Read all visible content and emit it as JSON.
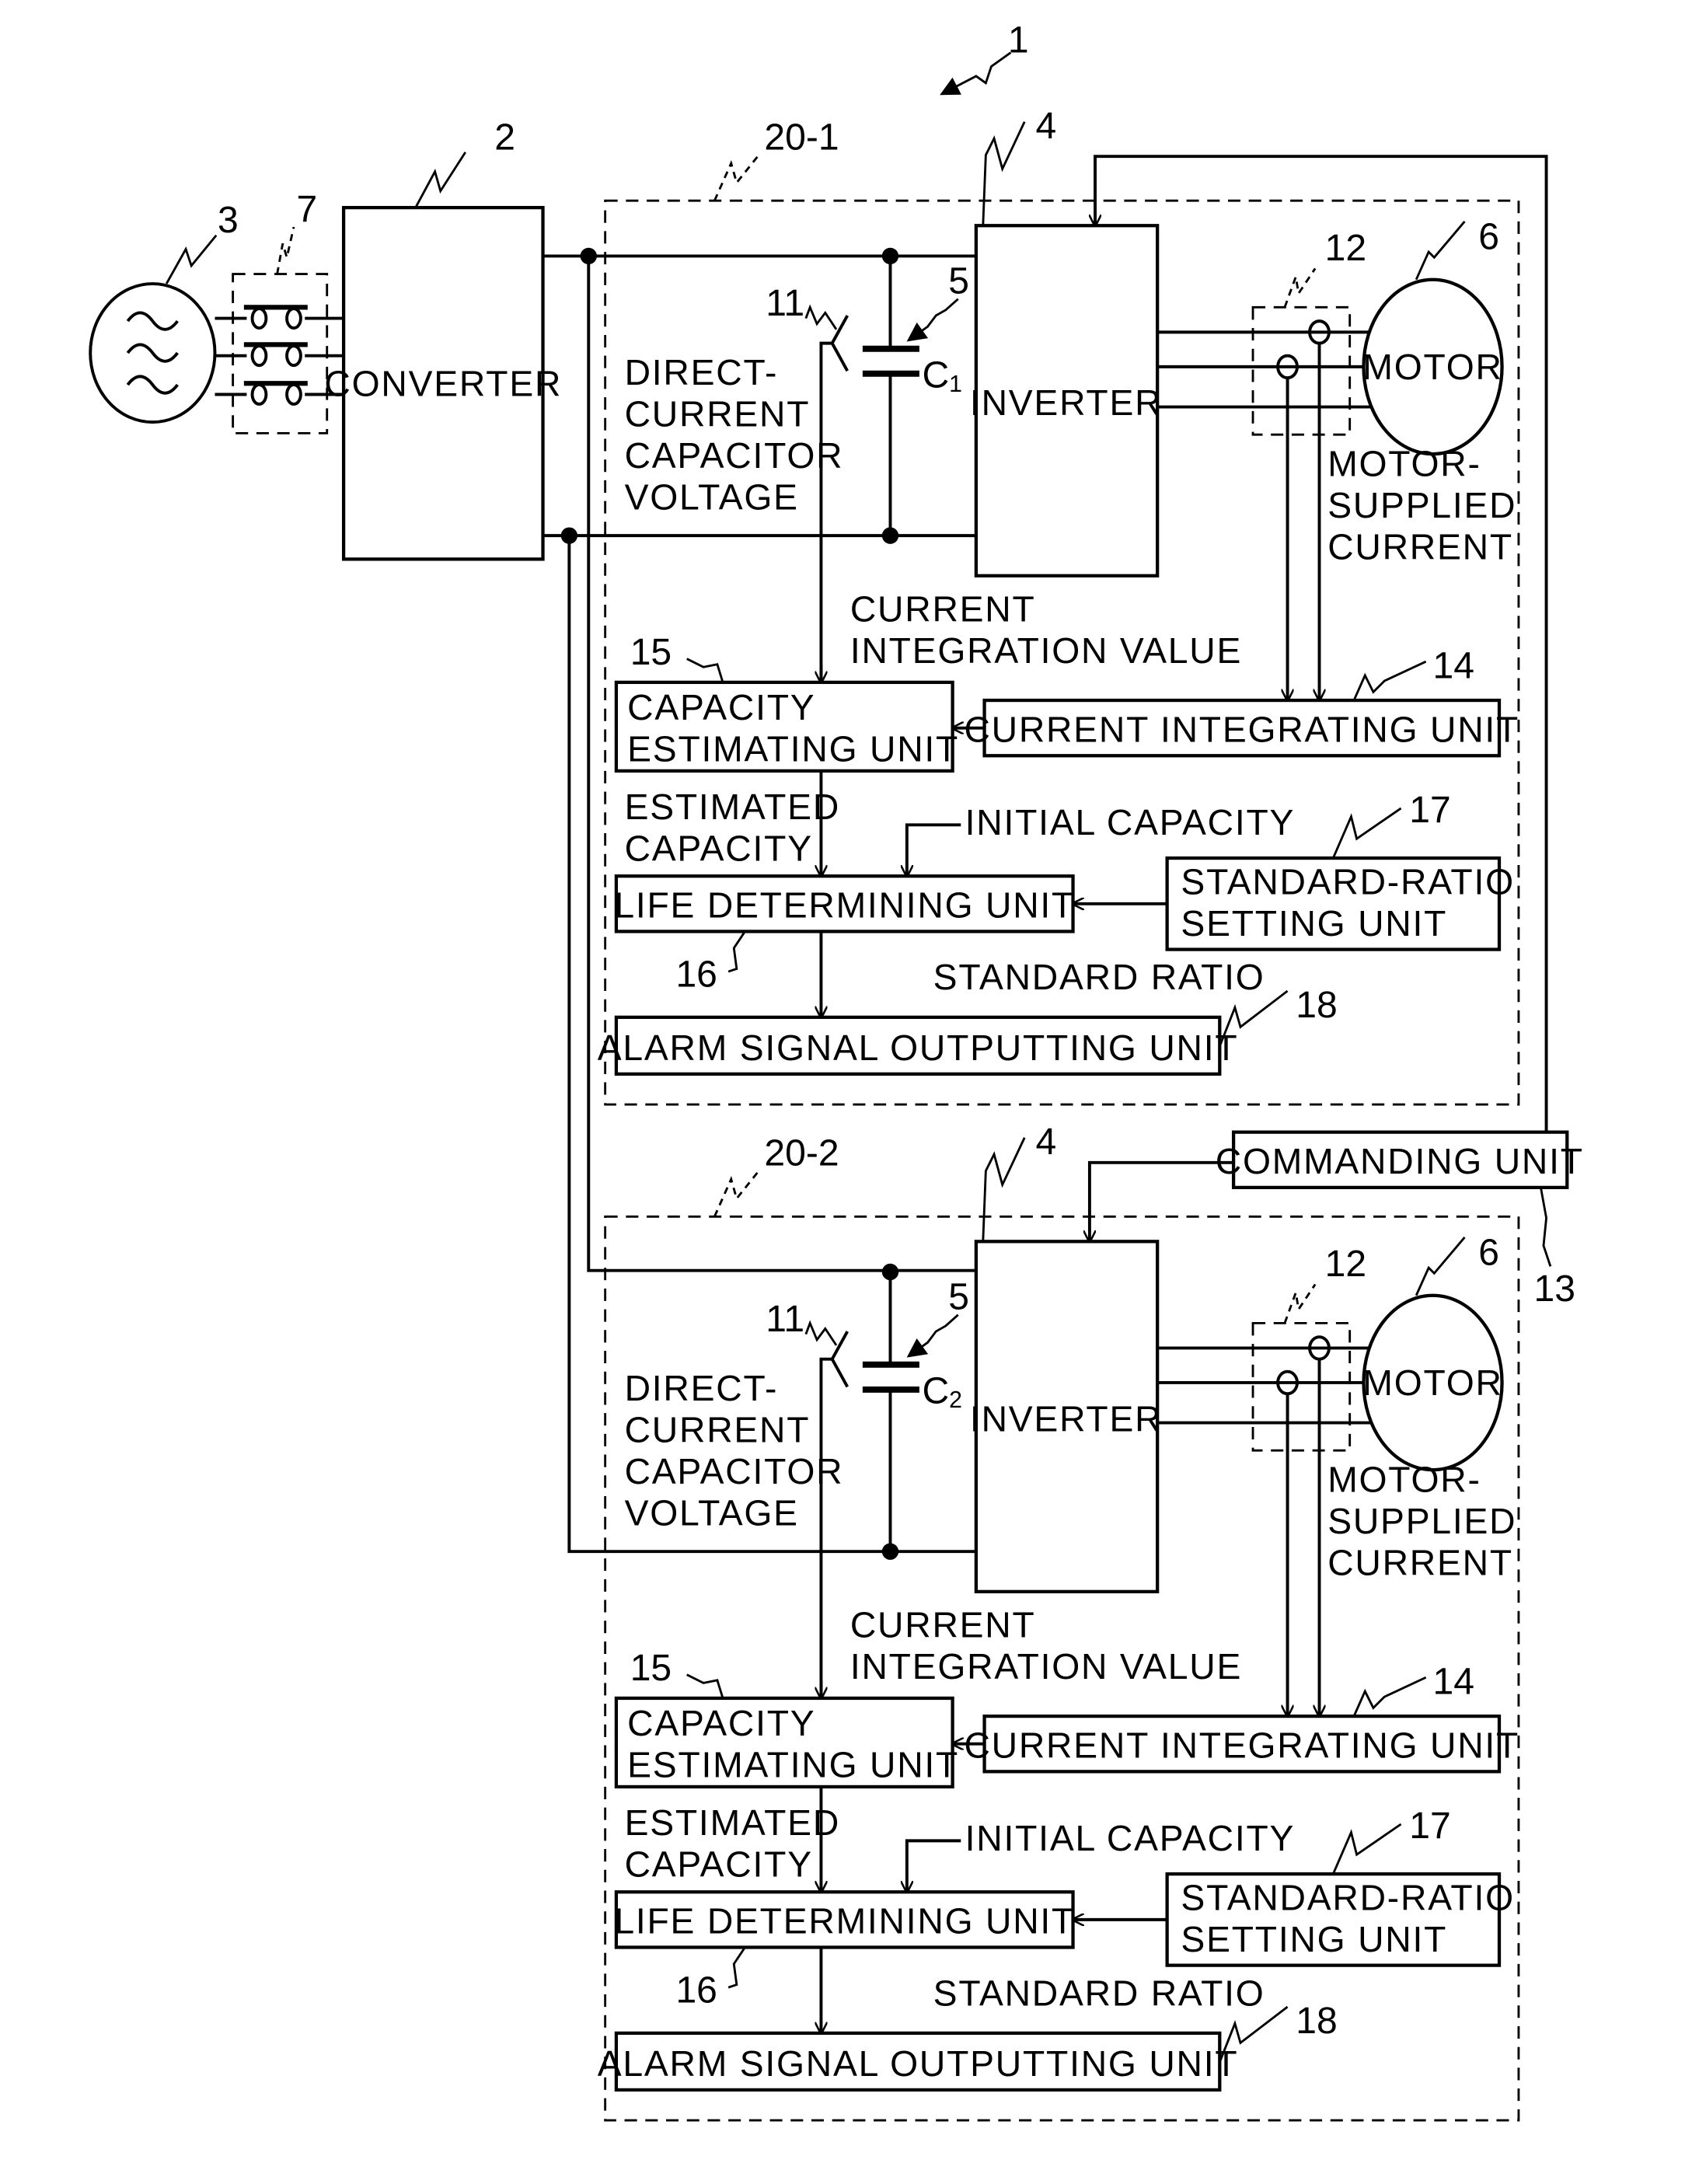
{
  "figure": {
    "system_ref": "1",
    "ac_source": {
      "ref": "3",
      "icon": "ac-source-icon"
    },
    "breaker": {
      "ref": "7",
      "icon": "breaker-contacts-icon"
    },
    "converter": {
      "ref": "2",
      "label": "CONVERTER"
    },
    "commanding_unit": {
      "ref": "13",
      "label": "COMMANDING UNIT"
    },
    "drive_units": [
      {
        "ref": "20-1",
        "inverter": {
          "ref": "4",
          "label": "INVERTER"
        },
        "capacitor": {
          "ref": "5",
          "name": "C",
          "index": "1"
        },
        "voltage_detector_ref": "11",
        "voltage_label": [
          "DIRECT-",
          "CURRENT",
          "CAPACITOR",
          "VOLTAGE"
        ],
        "current_sensor_ref": "12",
        "motor": {
          "ref": "6",
          "label": "MOTOR"
        },
        "motor_current_label": [
          "MOTOR-",
          "SUPPLIED",
          "CURRENT"
        ],
        "integration_label": [
          "CURRENT",
          "INTEGRATION VALUE"
        ],
        "capacity_estimating": {
          "ref": "15",
          "label": [
            "CAPACITY",
            "ESTIMATING UNIT"
          ]
        },
        "current_integrating": {
          "ref": "14",
          "label": "CURRENT INTEGRATING UNIT"
        },
        "estimated_label": [
          "ESTIMATED",
          "CAPACITY"
        ],
        "initial_label": "INITIAL CAPACITY",
        "life_determining": {
          "ref": "16",
          "label": "LIFE DETERMINING UNIT"
        },
        "standard_ratio_setting": {
          "ref": "17",
          "label": [
            "STANDARD-RATIO",
            "SETTING UNIT"
          ]
        },
        "standard_ratio_label": "STANDARD RATIO",
        "alarm": {
          "ref": "18",
          "label": "ALARM SIGNAL OUTPUTTING UNIT"
        }
      },
      {
        "ref": "20-2",
        "inverter": {
          "ref": "4",
          "label": "INVERTER"
        },
        "capacitor": {
          "ref": "5",
          "name": "C",
          "index": "2"
        },
        "voltage_detector_ref": "11",
        "voltage_label": [
          "DIRECT-",
          "CURRENT",
          "CAPACITOR",
          "VOLTAGE"
        ],
        "current_sensor_ref": "12",
        "motor": {
          "ref": "6",
          "label": "MOTOR"
        },
        "motor_current_label": [
          "MOTOR-",
          "SUPPLIED",
          "CURRENT"
        ],
        "integration_label": [
          "CURRENT",
          "INTEGRATION VALUE"
        ],
        "capacity_estimating": {
          "ref": "15",
          "label": [
            "CAPACITY",
            "ESTIMATING UNIT"
          ]
        },
        "current_integrating": {
          "ref": "14",
          "label": "CURRENT INTEGRATING UNIT"
        },
        "estimated_label": [
          "ESTIMATED",
          "CAPACITY"
        ],
        "initial_label": "INITIAL CAPACITY",
        "life_determining": {
          "ref": "16",
          "label": "LIFE DETERMINING UNIT"
        },
        "standard_ratio_setting": {
          "ref": "17",
          "label": [
            "STANDARD-RATIO",
            "SETTING UNIT"
          ]
        },
        "standard_ratio_label": "STANDARD RATIO",
        "alarm": {
          "ref": "18",
          "label": "ALARM SIGNAL OUTPUTTING UNIT"
        }
      }
    ]
  }
}
